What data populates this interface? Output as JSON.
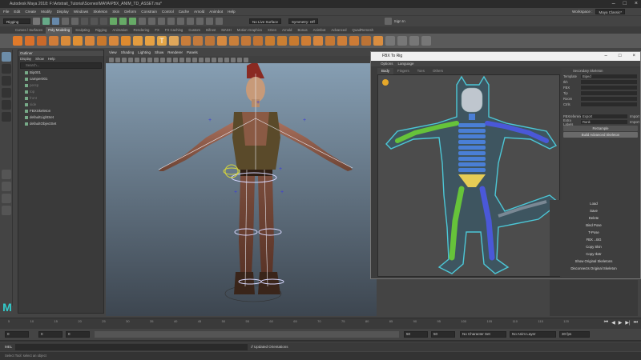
{
  "window": {
    "title": "Autodesk Maya 2018: F:\\Artstrait_Tutorial\\Scenes\\MAYA\\PBX_ANIM_TD_ASSET.ma*"
  },
  "menu": {
    "items": [
      "File",
      "Edit",
      "Create",
      "Modify",
      "Display",
      "Windows",
      "Skeleton",
      "Skin",
      "Deform",
      "Constrain",
      "Control",
      "Cache",
      "Arnold",
      "Animbot",
      "Help"
    ],
    "mode": "Rigging",
    "workspace_label": "Workspace :",
    "workspace": "Maya Classic*"
  },
  "status_line": {
    "live_surface": "No Live Surface",
    "symmetry": "Symmetry: Off",
    "sign_in": "Sign In"
  },
  "shelf": {
    "tabs": [
      "Curves / Surfaces",
      "Poly Modeling",
      "Sculpting",
      "Rigging",
      "Animation",
      "Rendering",
      "FX",
      "FX Caching",
      "Custom",
      "Bifrost",
      "MASH",
      "Motion Graphics",
      "XGen",
      "Arnold",
      "Bonus",
      "Animbot",
      "Advanced",
      "QuadRemesh"
    ],
    "active_tab": "Poly Modeling"
  },
  "outliner": {
    "title": "Outliner",
    "menu": [
      "Display",
      "Show",
      "Help"
    ],
    "search_placeholder": "Search...",
    "items": [
      {
        "label": "Bip001",
        "dim": false
      },
      {
        "label": "camper001",
        "dim": false
      },
      {
        "label": "persp",
        "dim": true
      },
      {
        "label": "top",
        "dim": true
      },
      {
        "label": "front",
        "dim": true
      },
      {
        "label": "side",
        "dim": true
      },
      {
        "label": "FBXSkeleton",
        "dim": false
      },
      {
        "label": "defaultLightSet",
        "dim": false
      },
      {
        "label": "defaultObjectSet",
        "dim": false
      }
    ]
  },
  "viewport": {
    "menu": [
      "View",
      "Shading",
      "Lighting",
      "Show",
      "Renderer",
      "Panels"
    ]
  },
  "fbx_to_rig": {
    "title": "FBX To Rig",
    "menu": [
      "Options",
      "Language"
    ],
    "tabs": [
      "Body",
      "Fingers",
      "Toes",
      "Others"
    ],
    "active_tab": "Body",
    "secondary_skeleton": "Secondary Skeleton",
    "fields": [
      {
        "label": "Template",
        "value": "Biped"
      },
      {
        "label": "Ikh",
        "value": ""
      },
      {
        "label": "FBX",
        "value": ""
      },
      {
        "label": "Tip",
        "value": ""
      },
      {
        "label": "Room",
        "value": ""
      },
      {
        "label": "Ctrls",
        "value": ""
      }
    ],
    "fbx_reference": {
      "label": "FBXreference",
      "value": "Export",
      "action": "Import"
    },
    "extra_labels": {
      "label": "Extra Labels",
      "value": "Rank",
      "action": "Import"
    },
    "resample": "ReSample",
    "build": "Build Advanced Skeleton",
    "buttons": [
      "Load",
      "Save",
      "Delete",
      "Bind Pose",
      "T-Pose",
      "FBX→BG",
      "Copy Skin",
      "Copy Ikstr",
      "Show Original Skeletons",
      "Disconnects Original Skeleton"
    ]
  },
  "timeline": {
    "ticks": [
      "5",
      "10",
      "15",
      "20",
      "25",
      "30",
      "35",
      "40",
      "45",
      "50",
      "55",
      "60",
      "65",
      "70",
      "75",
      "80",
      "85",
      "90",
      "95",
      "100",
      "105",
      "110",
      "115",
      "120"
    ],
    "start": "0",
    "range_start": "0",
    "current": "0",
    "range_end": "50",
    "end": "50",
    "char_set": "No Character Set",
    "anim_layer": "No Anim Layer",
    "fps": "30 fps"
  },
  "command": {
    "lang": "MEL",
    "result": "// Updated Orientations"
  },
  "help_line": "Select Tool: select an object",
  "colors": {
    "accent": "#4cc7d6",
    "spine": "#4a7fd6",
    "left": "#66c33a",
    "right": "#4a58d8",
    "center": "#c8c8c8",
    "gold": "#e6cc55"
  }
}
